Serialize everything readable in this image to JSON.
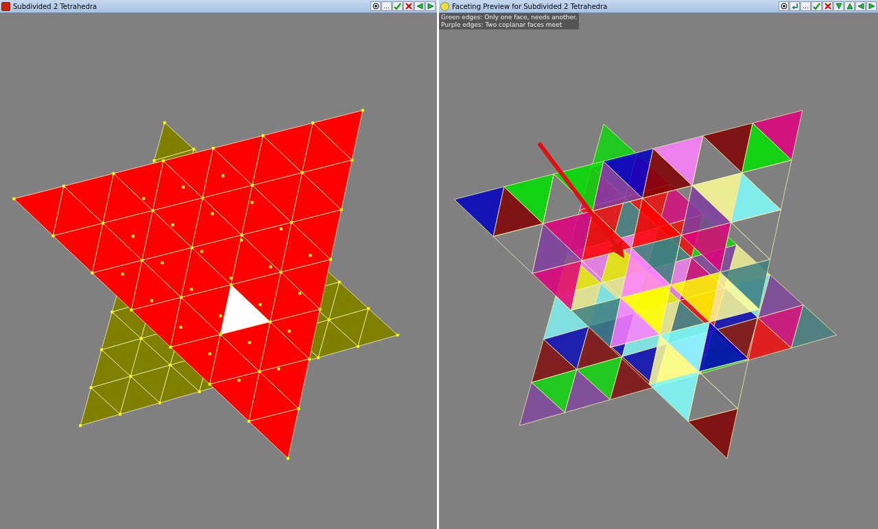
{
  "left_window": {
    "title": "Subdivided 2 Tetrahedra",
    "toolbar": [
      {
        "kind": "target"
      },
      {
        "kind": "ellipsis",
        "label": "..."
      },
      {
        "kind": "check"
      },
      {
        "kind": "cross"
      },
      {
        "kind": "left"
      },
      {
        "kind": "right"
      }
    ]
  },
  "right_window": {
    "title": "Faceting Preview for Subdivided 2 Tetrahedra",
    "toolbar": [
      {
        "kind": "target"
      },
      {
        "kind": "return"
      },
      {
        "kind": "ellipsis",
        "label": "..."
      },
      {
        "kind": "check"
      },
      {
        "kind": "cross"
      },
      {
        "kind": "down"
      },
      {
        "kind": "up"
      },
      {
        "kind": "left"
      },
      {
        "kind": "right"
      }
    ],
    "legend": [
      "Green edges: Only one face, needs another.",
      "Purple edges: Two coplanar faces meet"
    ]
  }
}
